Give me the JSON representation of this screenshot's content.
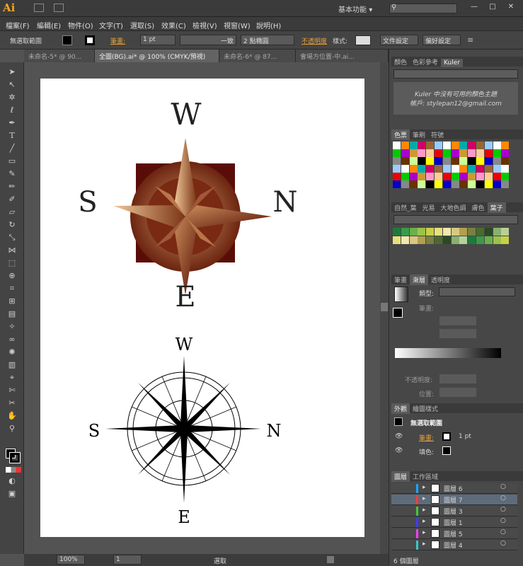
{
  "app": {
    "logo": "Ai",
    "workspace": "基本功能",
    "workspace_arrow": "▾"
  },
  "window_controls": {
    "minimize": "—",
    "maximize": "□",
    "close": "✕"
  },
  "menu": [
    "檔案(F)",
    "編輯(E)",
    "物件(O)",
    "文字(T)",
    "選取(S)",
    "效果(C)",
    "檢視(V)",
    "視窗(W)",
    "說明(H)"
  ],
  "control": {
    "selection": "無選取範圍",
    "stroke_label": "筆畫:",
    "stroke_value": "1 pt",
    "stroke_style": "一致",
    "brush": "2 點橢圓",
    "opacity_label": "不透明度",
    "style_label": "樣式:",
    "doc_setup": "文件設定",
    "prefs": "偏好設定"
  },
  "tabs": [
    {
      "label": "未命名-5* @ 90..."
    },
    {
      "label": "全圖(BG).ai* @ 100% (CMYK/預視)"
    },
    {
      "label": "未命名-6* @ 87..."
    },
    {
      "label": "會場方位置-中.ai..."
    }
  ],
  "status": {
    "zoom": "100%",
    "page": "1",
    "mode": "選取"
  },
  "compass_top": {
    "w": "W",
    "e": "E",
    "s": "S",
    "n": "N"
  },
  "compass_bottom": {
    "w": "W",
    "e": "E",
    "s": "S",
    "n": "N"
  },
  "panels": {
    "color_tabs": [
      "顏色",
      "色彩參考",
      "Kuler"
    ],
    "kuler_msg1": "Kuler 中沒有可用的顏色主題",
    "kuler_msg2": "帳戶: stylepan12@gmail.com",
    "swatch_tabs": [
      "色票",
      "筆刷",
      "符號"
    ],
    "lib_tabs": [
      "自然_葉",
      "光易",
      "大地色調",
      "膚色",
      "葉子"
    ],
    "grad_tabs": [
      "筆畫",
      "漸層",
      "透明度"
    ],
    "grad_type_label": "類型:",
    "grad_stroke_label": "筆畫:",
    "grad_opacity_label": "不透明度:",
    "grad_pos_label": "位置:",
    "appearance_tabs": [
      "外觀",
      "繪圖樣式"
    ],
    "appearance_title": "無選取範圍",
    "appearance_stroke": "筆畫:",
    "appearance_stroke_val": "1 pt",
    "appearance_fill": "填色:",
    "layer_tabs": [
      "圖層",
      "工作區域"
    ],
    "layers": [
      "圖層 6",
      "圖層 7",
      "圖層 3",
      "圖層 1",
      "圖層 5",
      "圖層 4"
    ],
    "layer_colors": [
      "#1fa3ff",
      "#ff3d3d",
      "#3dcc3d",
      "#3d3dff",
      "#ff3dff",
      "#33cccc"
    ],
    "layer_count": "6 個圖層"
  },
  "colors": {
    "accent": "#e8a03a",
    "bg": "#535353",
    "panel": "#474747"
  }
}
